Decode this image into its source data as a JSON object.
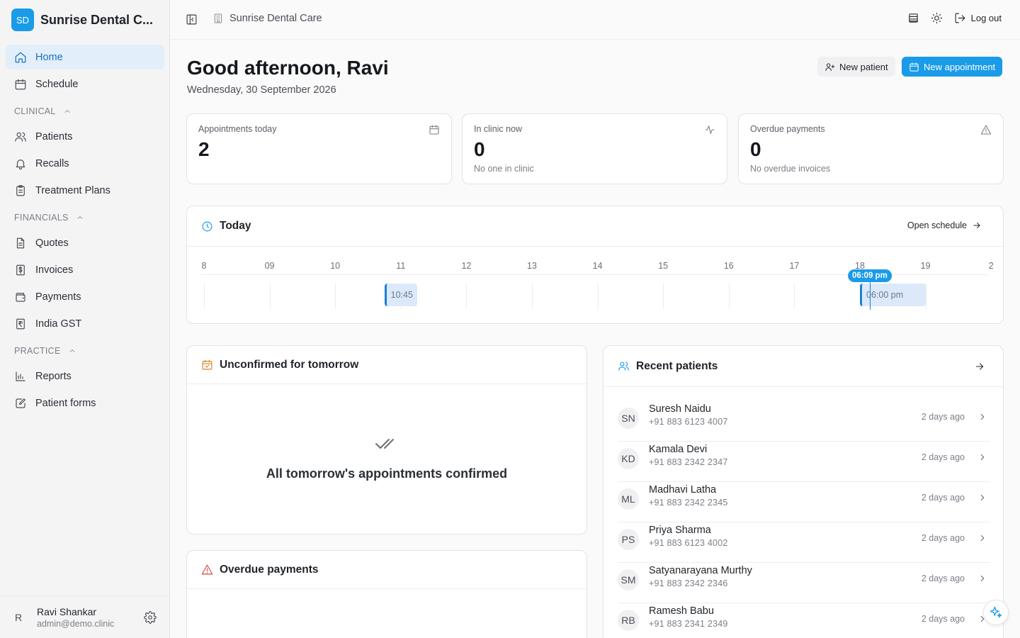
{
  "brand": {
    "initials": "SD",
    "name": "Sunrise Dental C..."
  },
  "nav": {
    "home": "Home",
    "schedule": "Schedule",
    "clinical": "CLINICAL",
    "patients": "Patients",
    "recalls": "Recalls",
    "treatment_plans": "Treatment Plans",
    "financials": "FINANCIALS",
    "quotes": "Quotes",
    "invoices": "Invoices",
    "payments": "Payments",
    "india_gst": "India GST",
    "practice": "PRACTICE",
    "reports": "Reports",
    "patient_forms": "Patient forms"
  },
  "user": {
    "initial": "R",
    "name": "Ravi Shankar",
    "email": "admin@demo.clinic"
  },
  "topbar": {
    "clinic": "Sunrise Dental Care",
    "logout": "Log out"
  },
  "header": {
    "greeting": "Good afternoon, Ravi",
    "date": "Wednesday, 30 September 2026",
    "new_patient": "New patient",
    "new_appointment": "New appointment"
  },
  "stats": {
    "appointments": {
      "label": "Appointments today",
      "value": "2"
    },
    "in_clinic": {
      "label": "In clinic now",
      "value": "0",
      "sub": "No one in clinic"
    },
    "overdue": {
      "label": "Overdue payments",
      "value": "0",
      "sub": "No overdue invoices"
    }
  },
  "today": {
    "title": "Today",
    "open_schedule": "Open schedule",
    "hours": [
      "8",
      "09",
      "10",
      "11",
      "12",
      "13",
      "14",
      "15",
      "16",
      "17",
      "18",
      "19",
      "2"
    ],
    "appointments": [
      {
        "time": "10:45",
        "start_hour": 10.75,
        "duration_hours": 0.5
      },
      {
        "time": "06:00 pm",
        "start_hour": 18.0,
        "duration_hours": 1.0
      }
    ],
    "now_label": "06:09 pm",
    "now_hour": 18.15
  },
  "unconfirmed": {
    "title": "Unconfirmed for tomorrow",
    "empty": "All tomorrow's appointments confirmed"
  },
  "overdue_card": {
    "title": "Overdue payments"
  },
  "recent": {
    "title": "Recent patients",
    "patients": [
      {
        "initials": "SN",
        "name": "Suresh Naidu",
        "phone": "+91 883 6123 4007",
        "when": "2 days ago"
      },
      {
        "initials": "KD",
        "name": "Kamala Devi",
        "phone": "+91 883 2342 2347",
        "when": "2 days ago"
      },
      {
        "initials": "ML",
        "name": "Madhavi Latha",
        "phone": "+91 883 2342 2345",
        "when": "2 days ago"
      },
      {
        "initials": "PS",
        "name": "Priya Sharma",
        "phone": "+91 883 6123 4002",
        "when": "2 days ago"
      },
      {
        "initials": "SM",
        "name": "Satyanarayana Murthy",
        "phone": "+91 883 2342 2346",
        "when": "2 days ago"
      },
      {
        "initials": "RB",
        "name": "Ramesh Babu",
        "phone": "+91 883 2341 2349",
        "when": "2 days ago"
      }
    ]
  },
  "colors": {
    "accent": "#1a9be8",
    "active_nav_bg": "#e2effb",
    "warning": "#d9822b",
    "danger": "#d64545"
  }
}
